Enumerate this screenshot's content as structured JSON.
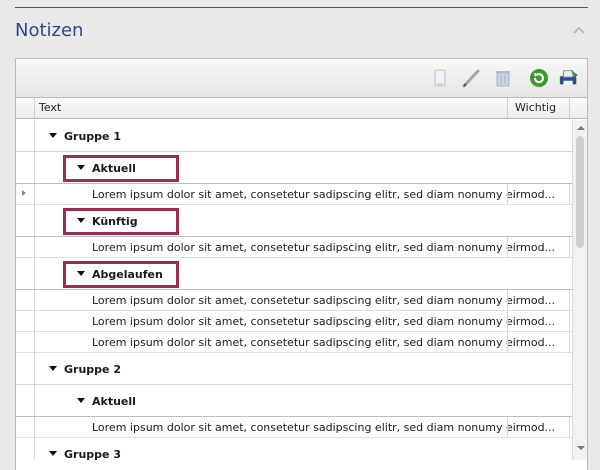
{
  "section": {
    "title": "Notizen"
  },
  "toolbar": {
    "icons": [
      "new-note-icon",
      "edit-pencil-icon",
      "delete-bin-icon",
      "refresh-icon",
      "print-icon"
    ]
  },
  "columns": {
    "text": "Text",
    "important": "Wichtig"
  },
  "groups": [
    {
      "label": "Gruppe 1",
      "subgroups": [
        {
          "label": "Aktuell",
          "rows": [
            "Lorem ipsum dolor sit amet, consetetur sadipscing elitr, sed diam nonumy eirmod..."
          ]
        },
        {
          "label": "Künftig",
          "rows": [
            "Lorem ipsum dolor sit amet, consetetur sadipscing elitr, sed diam nonumy eirmod..."
          ]
        },
        {
          "label": "Abgelaufen",
          "rows": [
            "Lorem ipsum dolor sit amet, consetetur sadipscing elitr, sed diam nonumy eirmod...",
            "Lorem ipsum dolor sit amet, consetetur sadipscing elitr, sed diam nonumy eirmod...",
            "Lorem ipsum dolor sit amet, consetetur sadipscing elitr, sed diam nonumy eirmod..."
          ]
        }
      ]
    },
    {
      "label": "Gruppe 2",
      "subgroups": [
        {
          "label": "Aktuell",
          "rows": [
            "Lorem ipsum dolor sit amet, consetetur sadipscing elitr, sed diam nonumy eirmod..."
          ]
        }
      ]
    },
    {
      "label": "Gruppe 3",
      "subgroups": []
    }
  ],
  "colors": {
    "highlight": "#9b2c55",
    "title": "#2b4a80"
  }
}
